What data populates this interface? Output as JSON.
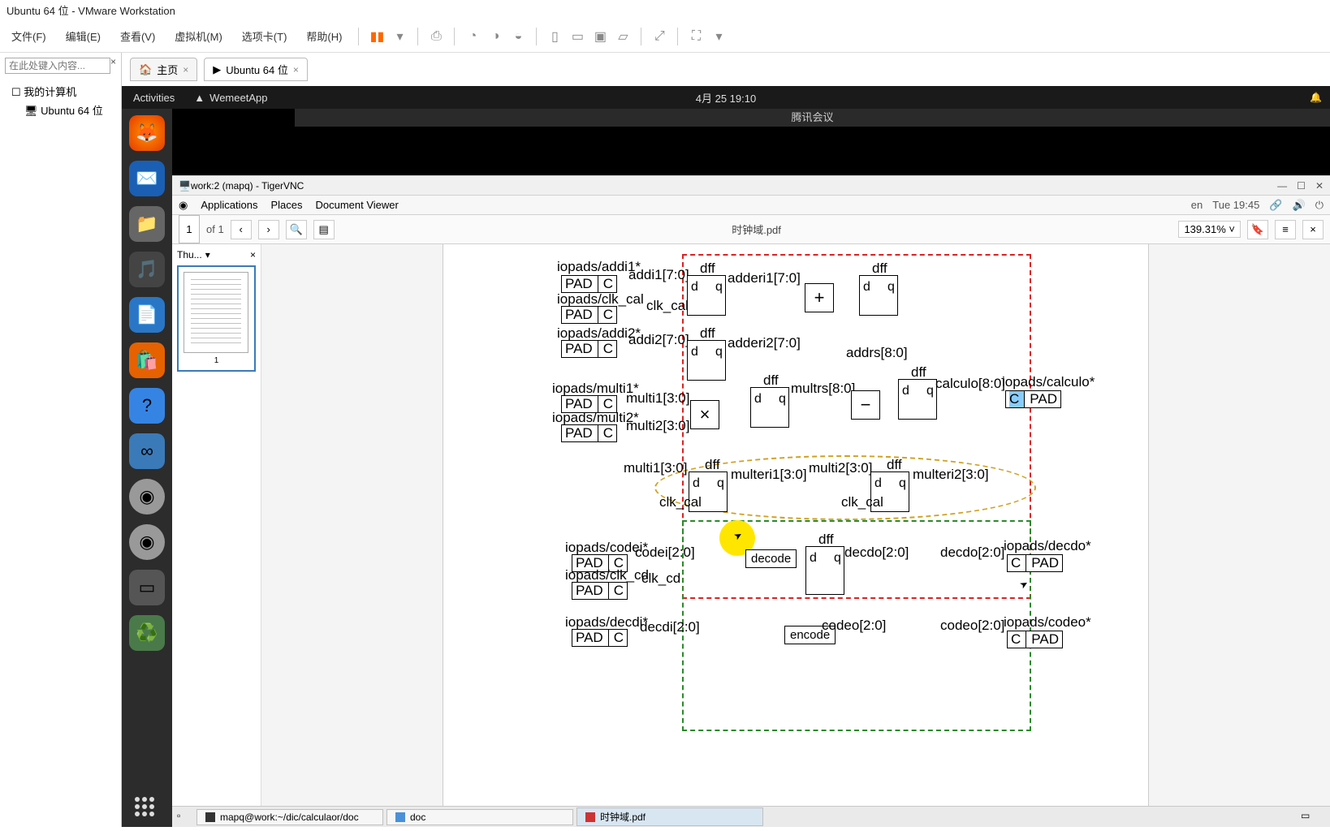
{
  "vmware": {
    "title": "Ubuntu 64 位 - VMware Workstation",
    "menus": [
      "文件(F)",
      "编辑(E)",
      "查看(V)",
      "虚拟机(M)",
      "选项卡(T)",
      "帮助(H)"
    ],
    "search_placeholder": "在此处键入内容...",
    "tree": {
      "root": "我的计算机",
      "vm": "Ubuntu 64 位"
    },
    "tabs": {
      "home": "主页",
      "vm": "Ubuntu 64 位"
    }
  },
  "ubuntu": {
    "activities": "Activities",
    "app": "WemeetApp",
    "clock": "4月 25  19:10",
    "meeting_title": "腾讯会议"
  },
  "vnc": {
    "title": "work:2 (mapq) - TigerVNC",
    "menus": [
      "Applications",
      "Places",
      "Document Viewer"
    ],
    "lang": "en",
    "datetime": "Tue 19:45"
  },
  "docbar": {
    "page": "1",
    "of": "of 1",
    "doc_title": "时钟域.pdf",
    "zoom": "139.31%"
  },
  "thumb": {
    "label": "Thu...",
    "num": "1"
  },
  "schem": {
    "p_addi1": "iopads/addi1*",
    "pad": "PAD",
    "c": "C",
    "addi1": "addi1[7:0]",
    "dff": "dff",
    "d": "d",
    "q": "q",
    "adderi1": "adderi1[7:0]",
    "p_clk_cal": "iopads/clk_cal",
    "clk_cal": "clk_cal",
    "p_addi2": "iopads/addi2*",
    "addi2": "addi2[7:0]",
    "adderi2": "adderi2[7:0]",
    "addrs": "addrs[8:0]",
    "p_multi1": "iopads/multi1*",
    "multi1": "multi1[3:0]",
    "p_multi2": "iopads/multi2*",
    "multi2": "multi2[3:0]",
    "multrs": "multrs[8:0]",
    "calculo": "calculo[8:0]",
    "p_calculo": "iopads/calculo*",
    "multeri1": "multeri1[3:0]",
    "multeri2": "multeri2[3:0]",
    "p_codei": "iopads/codei*",
    "codei": "codei[2:0]",
    "p_clk_cd": "iopads/clk_cd",
    "clk_cd": "clk_cd",
    "decode": "decode",
    "decdo": "decdo[2:0]",
    "decdo2": "decdo[2:0]",
    "p_decdo": "iopads/decdo*",
    "p_decdi": "iopads/decdi*",
    "decdi": "decdi[2:0]",
    "encode": "encode",
    "codeo": "codeo[2:0]",
    "codeo2": "codeo[2:0]",
    "p_codeo": "iopads/codeo*",
    "plus": "+",
    "times": "×",
    "minus": "−"
  },
  "taskbar": {
    "term": "mapq@work:~/dic/calculaor/doc",
    "fm": "doc",
    "pdf": "时钟域.pdf"
  }
}
